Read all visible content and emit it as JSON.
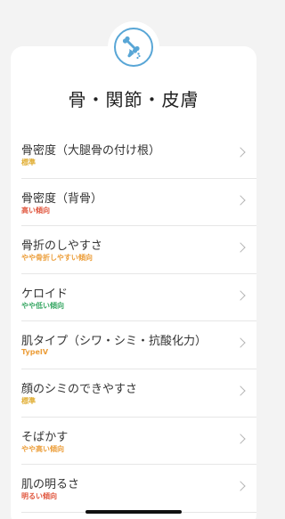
{
  "header": {
    "category_icon": "bone-icon",
    "title": "骨・関節・皮膚"
  },
  "colors": {
    "yellow": "#e0ac2f",
    "red": "#e0573f",
    "orange": "#ec9e3a",
    "green": "#3aa865",
    "icon_blue": "#58a6d6"
  },
  "items": [
    {
      "label": "骨密度（大腿骨の付け根）",
      "value": "標準",
      "color": "#e0ac2f"
    },
    {
      "label": "骨密度（背骨）",
      "value": "高い傾向",
      "color": "#e0573f"
    },
    {
      "label": "骨折のしやすさ",
      "value": "やや骨折しやすい傾向",
      "color": "#ec9e3a"
    },
    {
      "label": "ケロイド",
      "value": "やや低い傾向",
      "color": "#3aa865"
    },
    {
      "label": "肌タイプ（シワ・シミ・抗酸化力）",
      "value": "TypeIV",
      "color": "#ec9e3a"
    },
    {
      "label": "顔のシミのできやすさ",
      "value": "標準",
      "color": "#e0ac2f"
    },
    {
      "label": "そばかす",
      "value": "やや高い傾向",
      "color": "#ec9e3a"
    },
    {
      "label": "肌の明るさ",
      "value": "明るい傾向",
      "color": "#e0573f"
    }
  ]
}
